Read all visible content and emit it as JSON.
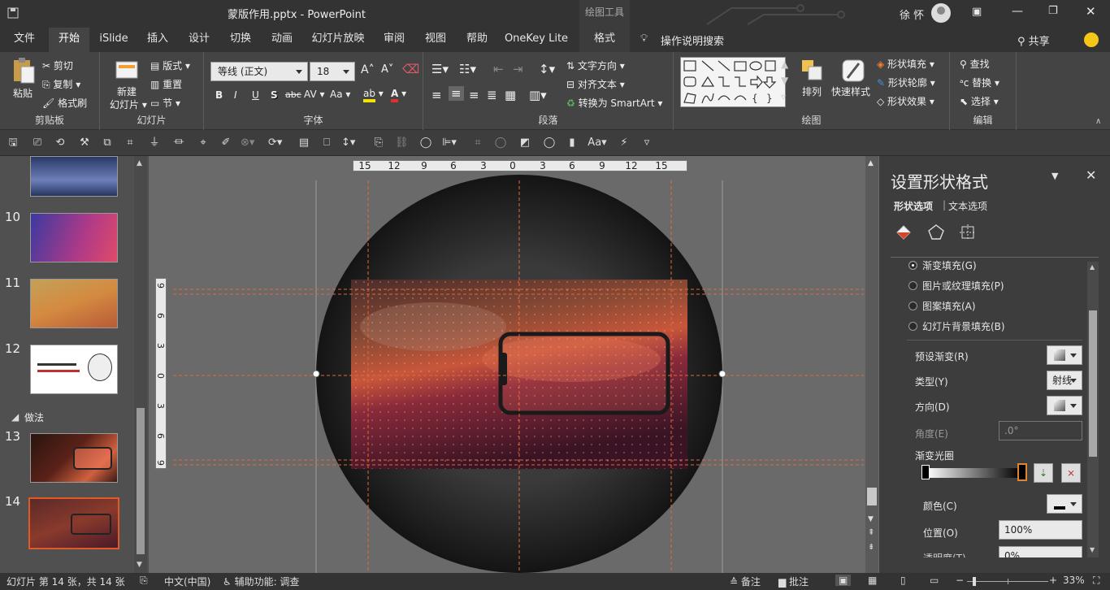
{
  "titlebar": {
    "title": "蒙版作用.pptx  -  PowerPoint",
    "context_tool": "绘图工具",
    "user": "徐 怀"
  },
  "tabs": [
    "文件",
    "开始",
    "iSlide",
    "插入",
    "设计",
    "切换",
    "动画",
    "幻灯片放映",
    "审阅",
    "视图",
    "帮助",
    "OneKey Lite",
    "格式"
  ],
  "tell_me": "操作说明搜索",
  "share": "共享",
  "ribbon": {
    "clipboard": {
      "paste": "粘贴",
      "cut": "剪切",
      "copy": "复制",
      "format_painter": "格式刷",
      "label": "剪贴板"
    },
    "slides": {
      "new_slide": "新建",
      "new_slide2": "幻灯片",
      "layout": "版式",
      "reset": "重置",
      "section": "节",
      "label": "幻灯片"
    },
    "font": {
      "name": "等线 (正文)",
      "size": "18",
      "label": "字体",
      "bold": "B",
      "italic": "I",
      "underline": "U",
      "shadow": "S",
      "strike": "abc",
      "spacing": "AV",
      "case": "Aa",
      "grow": "A",
      "shrink": "A"
    },
    "paragraph": {
      "text_direction": "文字方向",
      "align_text": "对齐文本",
      "smartart": "转换为 SmartArt",
      "label": "段落"
    },
    "drawing": {
      "arrange": "排列",
      "quick_styles": "快速样式",
      "fill": "形状填充",
      "outline": "形状轮廓",
      "effects": "形状效果",
      "label": "绘图"
    },
    "editing": {
      "find": "查找",
      "replace": "替换",
      "select": "选择",
      "label": "编辑"
    }
  },
  "thumbs": {
    "numbers": [
      "10",
      "11",
      "12",
      "13",
      "14"
    ],
    "section": "做法"
  },
  "ruler": {
    "h": [
      "15",
      "12",
      "9",
      "6",
      "3",
      "0",
      "3",
      "6",
      "9",
      "12",
      "15"
    ],
    "v": [
      "9",
      "6",
      "3",
      "0",
      "3",
      "6",
      "9"
    ]
  },
  "pane": {
    "title": "设置形状格式",
    "tab_shape": "形状选项",
    "tab_text": "文本选项",
    "fill_options": [
      "渐变填充(G)",
      "图片或纹理填充(P)",
      "图案填充(A)",
      "幻灯片背景填充(B)"
    ],
    "preset": "预设渐变(R)",
    "type": "类型(Y)",
    "type_value": "射线",
    "direction": "方向(D)",
    "angle": "角度(E)",
    "angle_value": ".0°",
    "stops": "渐变光圈",
    "color": "颜色(C)",
    "position": "位置(O)",
    "position_value": "100%",
    "transparency": "透明度(T)",
    "transparency_value": "0%"
  },
  "status": {
    "slide": "幻灯片 第 14 张，共 14 张",
    "lang": "中文(中国)",
    "access": "辅助功能: 调查",
    "notes": "备注",
    "comments": "批注",
    "zoom": "33%"
  },
  "colors": {
    "accent": "#d04a2e",
    "guide": "#e2683a",
    "ribbon": "#444444",
    "title": "#333333"
  }
}
